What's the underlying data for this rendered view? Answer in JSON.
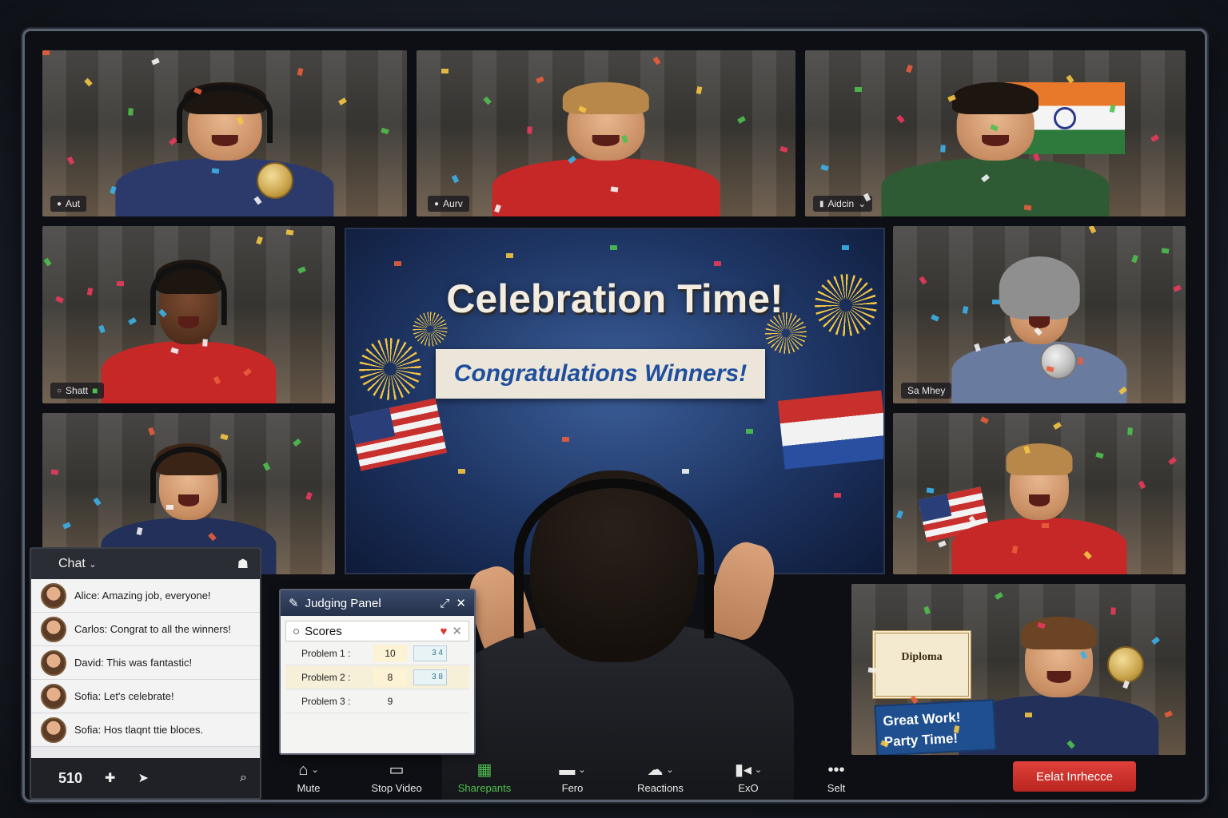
{
  "participants": [
    {
      "name": "Aut",
      "shirt": "#2b3a6a"
    },
    {
      "name": "Aurv",
      "shirt": "#c62828"
    },
    {
      "name": "Aidcin",
      "shirt": "#2e5b33"
    },
    {
      "name": "Shatt",
      "shirt": "#c62828"
    },
    {
      "name": "",
      "shirt": "#22305a"
    },
    {
      "name": "Sa Mhey",
      "shirt": "#6a7ba0"
    },
    {
      "name": "",
      "shirt": "#c62828"
    },
    {
      "name": "",
      "shirt": "#22305a"
    }
  ],
  "slide": {
    "title": "Celebration Time!",
    "subtitle": "Congratulations Winners!"
  },
  "chat": {
    "title": "Chat",
    "messages": [
      {
        "text": "Alice: Amazing job, everyone!"
      },
      {
        "text": "Carlos: Congrat to all the winners!"
      },
      {
        "text": "David: This was fantastic!"
      },
      {
        "text": "Sofia: Let's celebrate!"
      },
      {
        "text": "Sofia: Hos tlaqnt ttie bloces."
      }
    ],
    "count": "510"
  },
  "judging": {
    "title": "Judging Panel",
    "scores_label": "Scores",
    "rows": [
      {
        "problem": "Problem 1 :",
        "value": "10",
        "badge": "3 4"
      },
      {
        "problem": "Problem 2 :",
        "value": "8",
        "badge": "3 8"
      },
      {
        "problem": "Problem 3 :",
        "value": "9",
        "badge": ""
      }
    ]
  },
  "toolbar": {
    "buttons": [
      {
        "label": "Mute",
        "icon": "mic-icon"
      },
      {
        "label": "Stop Video",
        "icon": "video-icon"
      },
      {
        "label": "Sharepants",
        "icon": "share-icon"
      },
      {
        "label": "Fero",
        "icon": "chat-bubble-icon"
      },
      {
        "label": "Reactions",
        "icon": "reactions-icon"
      },
      {
        "label": "ExO",
        "icon": "camera-icon"
      },
      {
        "label": "Selt",
        "icon": "more-icon"
      }
    ],
    "end_label": "Eelat Inrhecce"
  },
  "diploma": {
    "title": "Diploma",
    "sign_line1": "Great Work!",
    "sign_line2": "Party Time!"
  },
  "colors": {
    "accent_red": "#d93a34",
    "share_green": "#4ec04e",
    "slide_blue": "#1e3563"
  }
}
